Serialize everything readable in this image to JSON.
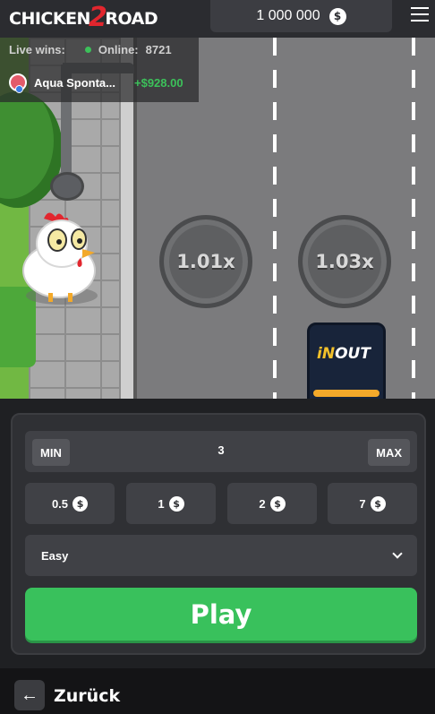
{
  "header": {
    "logo_text_left": "CHICKEN",
    "logo_number": "2",
    "logo_text_right": "ROAD",
    "balance": "1 000 000",
    "currency_symbol": "$"
  },
  "live": {
    "live_wins_label": "Live wins:",
    "online_label": "Online:",
    "online_count": "8721",
    "player_name": "Aqua Sponta...",
    "win_amount": "+$928.00"
  },
  "game": {
    "multipliers": [
      "1.01x",
      "1.03x"
    ],
    "truck_brand_in": "iN",
    "truck_brand_out": "OUT"
  },
  "controls": {
    "min_label": "MIN",
    "max_label": "MAX",
    "bet_value": "3",
    "quick_bets": [
      "0.5",
      "1",
      "2",
      "7"
    ],
    "difficulty": "Easy",
    "play_label": "Play"
  },
  "footer": {
    "back_label": "Zurück"
  },
  "colors": {
    "accent_green": "#39c15c",
    "logo_red": "#e2262e",
    "background": "#1f2023"
  }
}
